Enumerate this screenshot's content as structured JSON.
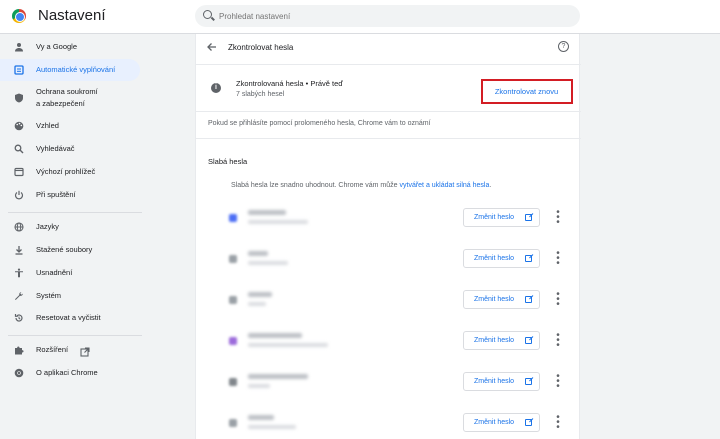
{
  "app": {
    "title": "Nastavení"
  },
  "search": {
    "placeholder": "Prohledat nastavení"
  },
  "sidebar": {
    "items": [
      {
        "label": "Vy a Google",
        "icon": "person-icon"
      },
      {
        "label": "Automatické vyplňování",
        "icon": "autofill-icon",
        "active": true
      },
      {
        "label": "Ochrana soukromí",
        "label2": "a zabezpečení",
        "icon": "shield-icon"
      },
      {
        "label": "Vzhled",
        "icon": "palette-icon"
      },
      {
        "label": "Vyhledávač",
        "icon": "search-icon"
      },
      {
        "label": "Výchozí prohlížeč",
        "icon": "browser-icon"
      },
      {
        "label": "Při spuštění",
        "icon": "power-icon"
      },
      {
        "label": "Jazyky",
        "icon": "globe-icon"
      },
      {
        "label": "Stažené soubory",
        "icon": "download-icon"
      },
      {
        "label": "Usnadnění",
        "icon": "accessibility-icon"
      },
      {
        "label": "Systém",
        "icon": "wrench-icon"
      },
      {
        "label": "Resetovat a vyčistit",
        "icon": "reset-icon"
      },
      {
        "label": "Rozšíření",
        "icon": "puzzle-icon"
      },
      {
        "label": "O aplikaci Chrome",
        "icon": "chrome-icon"
      }
    ]
  },
  "main": {
    "title": "Zkontrolovat hesla",
    "status_title": "Zkontrolovaná hesla • Právě teď",
    "status_sub": "7 slabých hesel",
    "check_again_label": "Zkontrolovat znovu",
    "notify_text": "Pokud se přihlásíte pomocí prolomeného hesla, Chrome vám to oznámí",
    "section_title": "Slabá hesla",
    "section_desc_prefix": "Slabá hesla lze snadno uhodnout. Chrome vám může ",
    "section_desc_link": "vytvářet a ukládat silná hesla",
    "section_desc_suffix": ".",
    "change_label": "Změnit heslo",
    "rows": [
      {
        "favicon_color": "#4c6ef5"
      },
      {
        "favicon_color": "#9aa0a6"
      },
      {
        "favicon_color": "#9aa0a6"
      },
      {
        "favicon_color": "#9c6bdb"
      },
      {
        "favicon_color": "#80868b"
      },
      {
        "favicon_color": "#9aa0a6"
      }
    ]
  },
  "colors": {
    "accent": "#1a73e8",
    "highlight": "#d31d24",
    "active_bg": "#e8f0fe"
  }
}
